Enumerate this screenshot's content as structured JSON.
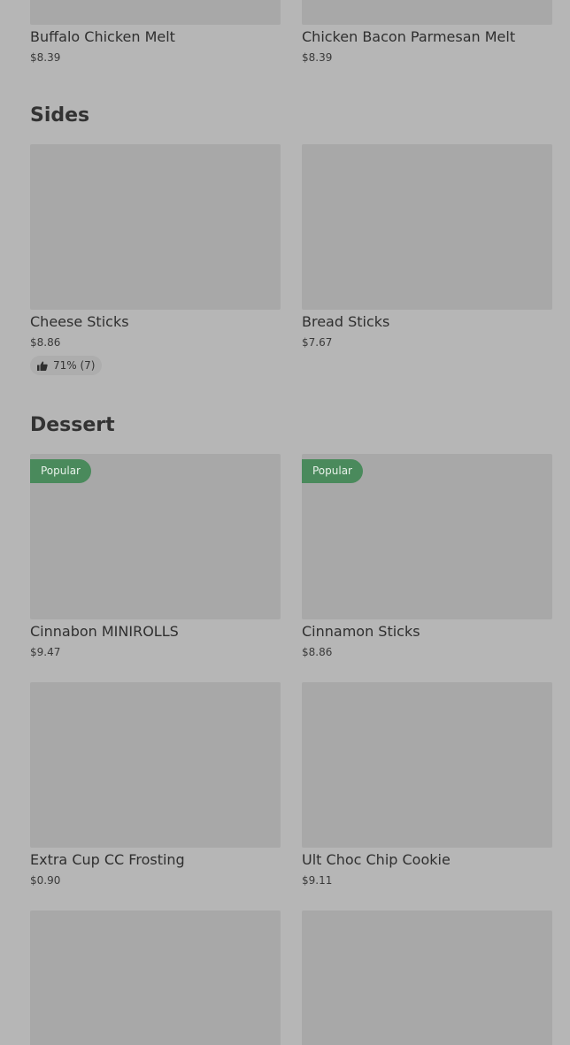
{
  "top_row": [
    {
      "name": "Buffalo Chicken Melt",
      "price": "$8.39"
    },
    {
      "name": "Chicken Bacon Parmesan Melt",
      "price": "$8.39"
    }
  ],
  "sides": {
    "title": "Sides",
    "items": [
      {
        "name": "Cheese Sticks",
        "price": "$8.86",
        "rating": "71% (7)"
      },
      {
        "name": "Bread Sticks",
        "price": "$7.67"
      }
    ]
  },
  "dessert": {
    "title": "Dessert",
    "items": [
      {
        "name": "Cinnabon MINIROLLS",
        "price": "$9.47",
        "badge": "Popular"
      },
      {
        "name": "Cinnamon Sticks",
        "price": "$8.86",
        "badge": "Popular"
      },
      {
        "name": "Extra Cup CC Frosting",
        "price": "$0.90"
      },
      {
        "name": "Ult Choc Chip Cookie",
        "price": "$9.11"
      }
    ]
  },
  "colors": {
    "badge": "#4a8a5c",
    "background": "#b6b6b6",
    "image_placeholder": "#a8a8a8"
  },
  "icons": {
    "rating": "thumbs-up-icon"
  }
}
